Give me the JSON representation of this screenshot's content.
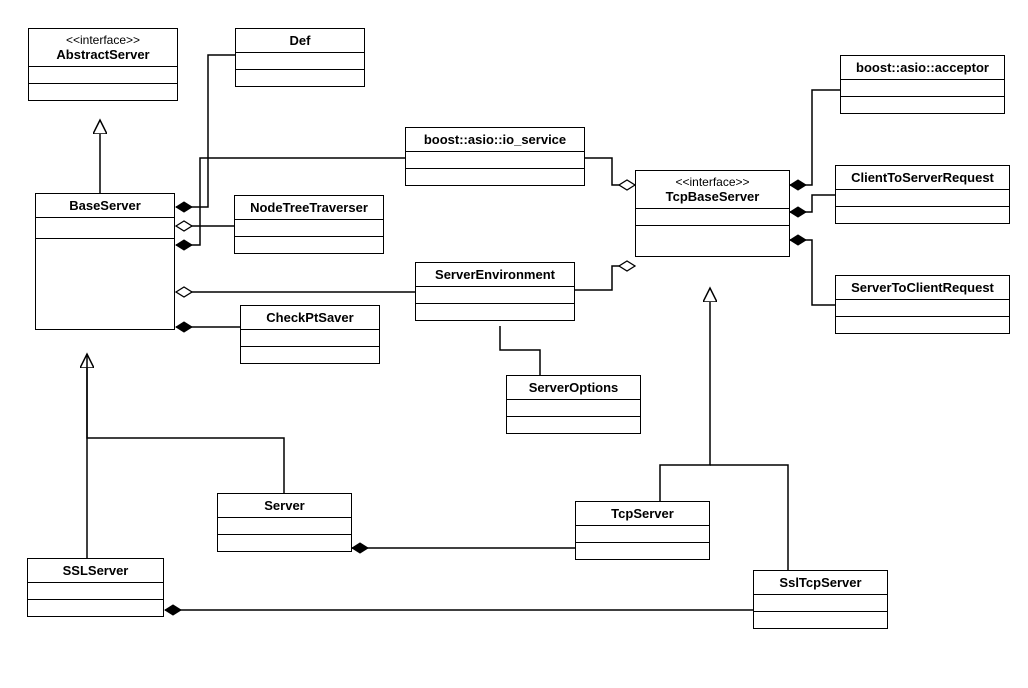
{
  "classes": {
    "abstractServer": {
      "stereotype": "<<interface>>",
      "name": "AbstractServer"
    },
    "def": {
      "name": "Def"
    },
    "baseServer": {
      "name": "BaseServer"
    },
    "nodeTreeTraverser": {
      "name": "NodeTreeTraverser"
    },
    "ioService": {
      "name": "boost::asio::io_service"
    },
    "tcpBaseServer": {
      "stereotype": "<<interface>>",
      "name": "TcpBaseServer"
    },
    "acceptor": {
      "name": "boost::asio::acceptor"
    },
    "clientToServerRequest": {
      "name": "ClientToServerRequest"
    },
    "serverToClientRequest": {
      "name": "ServerToClientRequest"
    },
    "serverEnvironment": {
      "name": "ServerEnvironment"
    },
    "checkPtSaver": {
      "name": "CheckPtSaver"
    },
    "serverOptions": {
      "name": "ServerOptions"
    },
    "server": {
      "name": "Server"
    },
    "tcpServer": {
      "name": "TcpServer"
    },
    "sslServer": {
      "name": "SSLServer"
    },
    "sslTcpServer": {
      "name": "SslTcpServer"
    }
  },
  "chart_data": {
    "type": "uml-class-diagram",
    "classes": [
      {
        "id": "AbstractServer",
        "stereotype": "interface"
      },
      {
        "id": "Def"
      },
      {
        "id": "BaseServer"
      },
      {
        "id": "NodeTreeTraverser"
      },
      {
        "id": "boost::asio::io_service"
      },
      {
        "id": "TcpBaseServer",
        "stereotype": "interface"
      },
      {
        "id": "boost::asio::acceptor"
      },
      {
        "id": "ClientToServerRequest"
      },
      {
        "id": "ServerToClientRequest"
      },
      {
        "id": "ServerEnvironment"
      },
      {
        "id": "CheckPtSaver"
      },
      {
        "id": "ServerOptions"
      },
      {
        "id": "Server"
      },
      {
        "id": "TcpServer"
      },
      {
        "id": "SSLServer"
      },
      {
        "id": "SslTcpServer"
      }
    ],
    "relationships": [
      {
        "from": "BaseServer",
        "to": "AbstractServer",
        "type": "generalization"
      },
      {
        "from": "Server",
        "to": "BaseServer",
        "type": "generalization"
      },
      {
        "from": "SSLServer",
        "to": "BaseServer",
        "type": "generalization"
      },
      {
        "from": "TcpServer",
        "to": "TcpBaseServer",
        "type": "generalization"
      },
      {
        "from": "SslTcpServer",
        "to": "TcpBaseServer",
        "type": "generalization"
      },
      {
        "from": "BaseServer",
        "to": "Def",
        "type": "composition"
      },
      {
        "from": "BaseServer",
        "to": "NodeTreeTraverser",
        "type": "aggregation"
      },
      {
        "from": "BaseServer",
        "to": "boost::asio::io_service",
        "type": "composition"
      },
      {
        "from": "BaseServer",
        "to": "CheckPtSaver",
        "type": "composition"
      },
      {
        "from": "BaseServer",
        "to": "ServerEnvironment",
        "type": "aggregation"
      },
      {
        "from": "TcpBaseServer",
        "to": "boost::asio::io_service",
        "type": "aggregation"
      },
      {
        "from": "TcpBaseServer",
        "to": "ServerEnvironment",
        "type": "aggregation"
      },
      {
        "from": "TcpBaseServer",
        "to": "boost::asio::acceptor",
        "type": "composition"
      },
      {
        "from": "TcpBaseServer",
        "to": "ClientToServerRequest",
        "type": "composition"
      },
      {
        "from": "TcpBaseServer",
        "to": "ServerToClientRequest",
        "type": "composition"
      },
      {
        "from": "ServerEnvironment",
        "to": "ServerOptions",
        "type": "association"
      },
      {
        "from": "Server",
        "to": "TcpServer",
        "type": "composition"
      },
      {
        "from": "SSLServer",
        "to": "SslTcpServer",
        "type": "composition"
      }
    ]
  }
}
